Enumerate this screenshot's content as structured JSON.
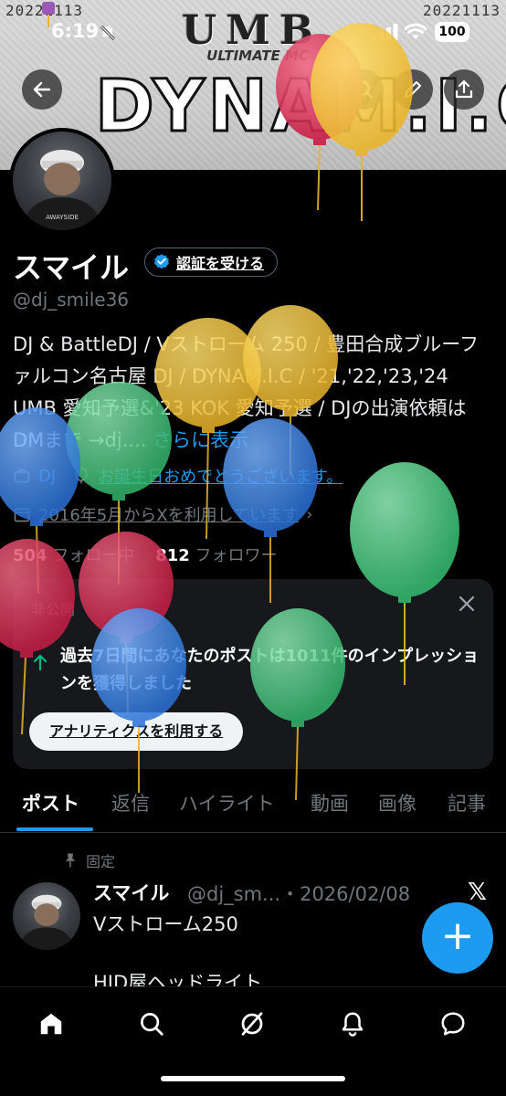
{
  "banner": {
    "date_left": "20221113",
    "date_right": "20221113",
    "title_top": "UMB",
    "subtitle": "ULTIMATE MC",
    "title_main": "DYNAM.I.C"
  },
  "status_bar": {
    "time": "6:19",
    "battery": "100"
  },
  "profile": {
    "name": "スマイル",
    "verify_label": "認証を受ける",
    "handle": "@dj_smile36",
    "bio": "DJ & BattleDJ / Vストローム 250 / 豊田合成ブルーファルコン名古屋 DJ / DYNAM.I.C / '21,'22,'23,'24 UMB 愛知予選&'23 KOK 愛知予選 / DJの出演依頼は DMまで →dj.... ",
    "bio_more": "さらに表示",
    "category": "DJ",
    "birthday": "お誕生日おめでとうございます。",
    "joined": "2016年5月からXを利用しています",
    "following_count": "504",
    "following_label": "フォロー中",
    "followers_count": "812",
    "followers_label": "フォロワー"
  },
  "analytics_card": {
    "private_label": "非公開",
    "message": "過去7日間にあなたのポストは1011件のインプレッションを獲得しました",
    "button": "アナリティクスを利用する"
  },
  "tabs": [
    "ポスト",
    "返信",
    "ハイライト",
    "動画",
    "画像",
    "記事"
  ],
  "pinned_post": {
    "pinned_label": "固定",
    "author": "スマイル",
    "handle_date": "@dj_sm...・2026/02/08",
    "line1": "Vストローム250",
    "line2": "HID屋ヘッドライト"
  },
  "colors": {
    "accent": "#1d9bf0",
    "background": "#000000"
  },
  "icons": [
    "back-icon",
    "search-icon",
    "edit-icon",
    "share-icon",
    "home-icon",
    "explore-icon",
    "grok-icon",
    "notifications-icon",
    "messages-icon"
  ]
}
